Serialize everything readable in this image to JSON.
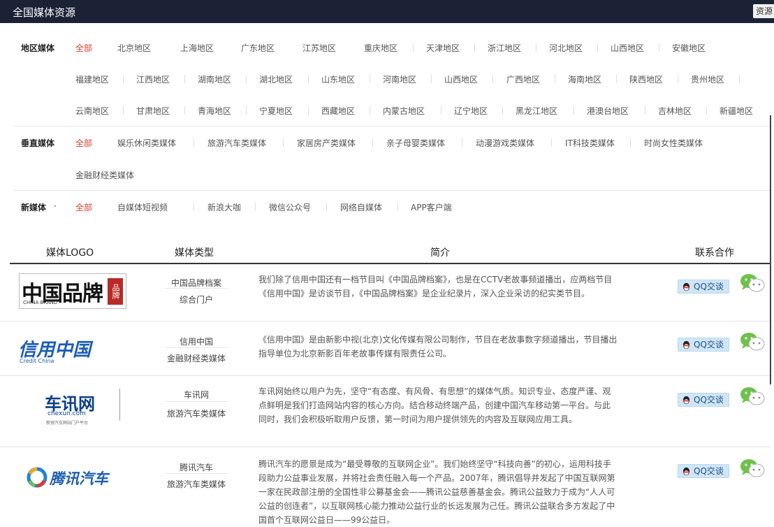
{
  "topbar": {
    "title": "全国媒体资源",
    "corner_label": "资源"
  },
  "filters": {
    "region": {
      "label": "地区媒体",
      "options": [
        "全部",
        "北京地区",
        "上海地区",
        "广东地区",
        "江苏地区",
        "重庆地区",
        "天津地区",
        "浙江地区",
        "河北地区",
        "山西地区",
        "安徽地区",
        "福建地区",
        "江西地区",
        "湖南地区",
        "湖北地区",
        "山东地区",
        "河南地区",
        "山西地区",
        "广西地区",
        "海南地区",
        "陕西地区",
        "贵州地区",
        "云南地区",
        "甘肃地区",
        "青海地区",
        "宁夏地区",
        "西藏地区",
        "内蒙古地区",
        "辽宁地区",
        "黑龙江地区",
        "港澳台地区",
        "吉林地区",
        "新疆地区"
      ]
    },
    "vertical": {
      "label": "垂直媒体",
      "options": [
        "全部",
        "娱乐休闲类媒体",
        "旅游汽车类媒体",
        "家居房产类媒体",
        "亲子母婴类媒体",
        "动漫游戏类媒体",
        "IT科技类媒体",
        "时尚女性类媒体",
        "金融财经类媒体"
      ]
    },
    "new_media": {
      "label": "新媒体",
      "options": [
        "全部",
        "自媒体短视频",
        "新浪大咖",
        "微信公众号",
        "网络自媒体",
        "APP客户端"
      ]
    }
  },
  "table": {
    "headers": [
      "媒体LOGO",
      "媒体类型",
      "简介",
      "联系合作"
    ],
    "qq_label": "QQ交谈",
    "rows": [
      {
        "logo_main": "中国品牌",
        "logo_sub": "CHINA BRAND",
        "logo_stamp": "品牌",
        "type": [
          "中国品牌档案",
          "综合门户"
        ],
        "desc": "我们除了信用中国还有一档节目叫《中国品牌档案》，也是在CCTV老故事频道播出，应两档节目《信用中国》是访谈节目，《中国品牌档案》是企业纪录片，深入企业采访的纪实类节目。"
      },
      {
        "logo_main": "信用中国",
        "logo_sub": "Credit China",
        "type": [
          "信用中国",
          "金融财经类媒体"
        ],
        "desc": "《信用中国》是由新影中视(北京)文化传媒有限公司制作，节目在老故事数字频道播出，节目播出指导单位为北京新影百年老故事传媒有限责任公司。"
      },
      {
        "logo_main": "车讯网",
        "logo_sub": "chexun.com",
        "logo_tag": "新锐汽车网站门户平台",
        "type": [
          "车讯网",
          "旅游汽车类媒体"
        ],
        "desc": "车讯网始终以用户为先，坚守“有态度、有风骨、有思想”的媒体气质。知识专业、态度严谨、观点鲜明是我们打造网站内容的核心方向。结合移动终端产品，创建中国汽车移动第一平台。与此同时，我们会积极听取用户反馈，第一时间为用户提供领先的内容及互联网应用工具。"
      },
      {
        "logo_main": "腾讯汽车",
        "type": [
          "腾讯汽车",
          "旅游汽车类媒体"
        ],
        "desc": "腾讯汽车的愿景是成为“最受尊敬的互联网企业”。我们始终坚守“科技向善”的初心，运用科技手段助力公益事业发展，并将社会责任融入每一个产品。2007年，腾讯倡导并发起了中国互联网第一家在民政部注册的全国性非公募基金会——腾讯公益慈善基金会。腾讯公益致力于成为“人人可公益的创连者”，以互联网核心能力推动公益行业的长远发展为己任。腾讯公益联合多方发起了中国首个互联网公益日——99公益日。"
      }
    ]
  },
  "colors": {
    "topbar": "#1b2235",
    "active": "#e23a2f",
    "qq_button": "#cfe6f7",
    "wechat": "#6cc24a"
  },
  "icons": {
    "qq": "qq-penguin-icon",
    "wechat": "wechat-icon"
  }
}
